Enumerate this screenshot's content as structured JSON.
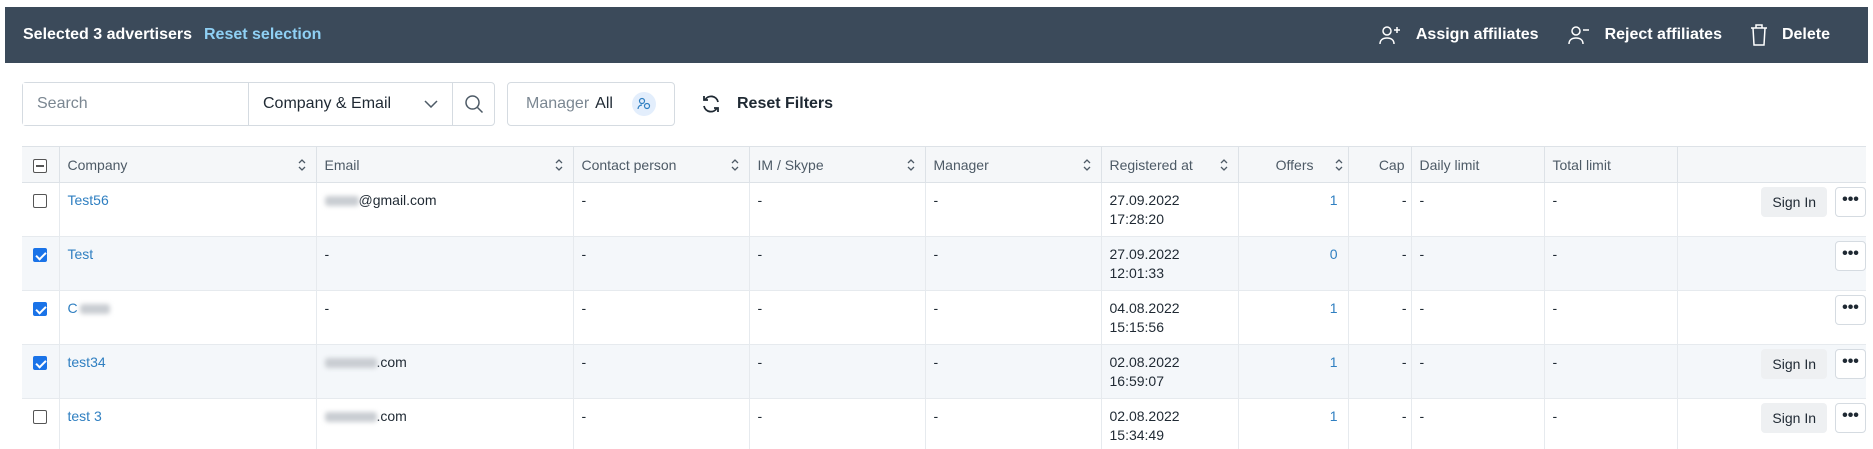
{
  "action_bar": {
    "selected_text": "Selected 3 advertisers",
    "reset_selection": "Reset selection",
    "assign": "Assign affiliates",
    "reject": "Reject affiliates",
    "delete": "Delete"
  },
  "filters": {
    "search_placeholder": "Search",
    "search_field": "Company & Email",
    "manager_label": "Manager",
    "manager_value": "All",
    "reset_filters": "Reset Filters"
  },
  "table": {
    "columns": [
      "Company",
      "Email",
      "Contact person",
      "IM / Skype",
      "Manager",
      "Registered at",
      "Offers",
      "Cap",
      "Daily limit",
      "Total limit"
    ],
    "sign_in_label": "Sign In",
    "more_label": "•••",
    "rows": [
      {
        "checked": false,
        "company": "Test56",
        "email": "@gmail.com",
        "email_blur": true,
        "contact": "-",
        "im": "-",
        "manager": "-",
        "date": "27.09.2022",
        "time": "17:28:20",
        "offers": "1",
        "cap": "-",
        "daily": "-",
        "total": "-",
        "sign_in": true
      },
      {
        "checked": true,
        "company": "Test",
        "email": "-",
        "email_blur": false,
        "contact": "-",
        "im": "-",
        "manager": "-",
        "date": "27.09.2022",
        "time": "12:01:33",
        "offers": "0",
        "cap": "-",
        "daily": "-",
        "total": "-",
        "sign_in": false
      },
      {
        "checked": true,
        "company": "C",
        "company_blur": true,
        "email": "-",
        "email_blur": false,
        "contact": "-",
        "im": "-",
        "manager": "-",
        "date": "04.08.2022",
        "time": "15:15:56",
        "offers": "1",
        "cap": "-",
        "daily": "-",
        "total": "-",
        "sign_in": false
      },
      {
        "checked": true,
        "company": "test34",
        "email": ".com",
        "email_blur": true,
        "contact": "-",
        "im": "-",
        "manager": "-",
        "date": "02.08.2022",
        "time": "16:59:07",
        "offers": "1",
        "cap": "-",
        "daily": "-",
        "total": "-",
        "sign_in": true
      },
      {
        "checked": false,
        "company": "test 3",
        "email": ".com",
        "email_blur": true,
        "contact": "-",
        "im": "-",
        "manager": "-",
        "date": "02.08.2022",
        "time": "15:34:49",
        "offers": "1",
        "cap": "-",
        "daily": "-",
        "total": "-",
        "sign_in": true
      }
    ]
  },
  "colors": {
    "header_bg": "#3b4a5a",
    "link": "#2f7fc1",
    "accent_link": "#8fd0f4"
  }
}
